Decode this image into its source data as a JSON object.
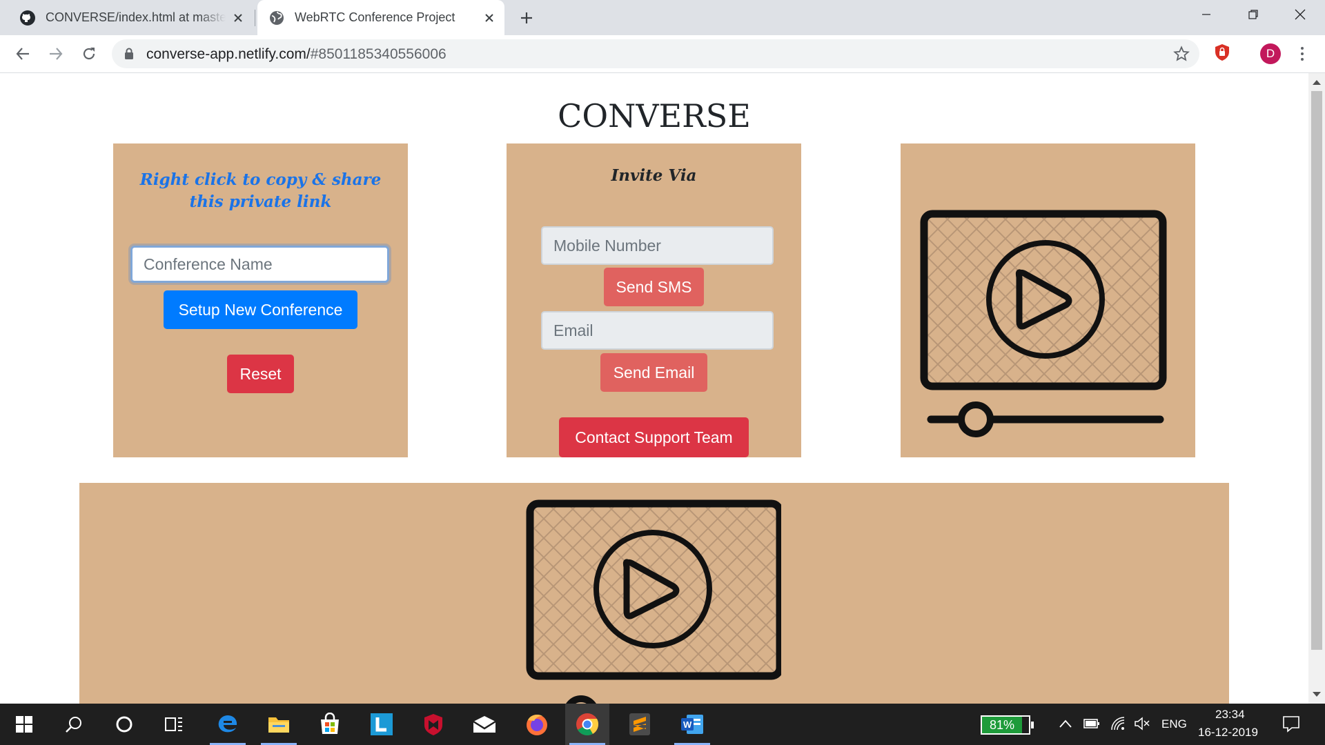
{
  "browser": {
    "tabs": [
      {
        "title": "CONVERSE/index.html at master",
        "favicon": "github-icon",
        "active": false
      },
      {
        "title": "WebRTC Conference Project",
        "favicon": "globe-icon",
        "active": true
      }
    ],
    "url_host": "converse-app.netlify.com/",
    "url_rest": "#8501185340556006",
    "profile_initial": "D"
  },
  "page": {
    "title": "CONVERSE",
    "share": {
      "hint_line1": "Right click to copy & share",
      "hint_line2": "this private link",
      "conference_placeholder": "Conference Name",
      "setup_label": "Setup New Conference",
      "reset_label": "Reset"
    },
    "invite": {
      "title": "Invite Via",
      "mobile_placeholder": "Mobile Number",
      "sms_label": "Send SMS",
      "email_placeholder": "Email",
      "email_label": "Send Email",
      "support_label": "Contact Support Team"
    }
  },
  "taskbar": {
    "apps": [
      "windows-start-icon",
      "search-icon",
      "cortana-icon",
      "task-view-icon",
      "edge-icon",
      "file-explorer-icon",
      "microsoft-store-icon",
      "l-app-icon",
      "mcafee-icon",
      "mail-icon",
      "firefox-icon",
      "chrome-icon",
      "sublime-text-icon",
      "word-icon"
    ],
    "battery_percent": "81%",
    "language": "ENG",
    "time": "23:34",
    "date": "16-12-2019"
  },
  "colors": {
    "panel": "#d8b28b",
    "primary": "#007bff",
    "danger": "#dc3545",
    "soft_danger": "#e0625f",
    "link_blue": "#1a73e8"
  }
}
